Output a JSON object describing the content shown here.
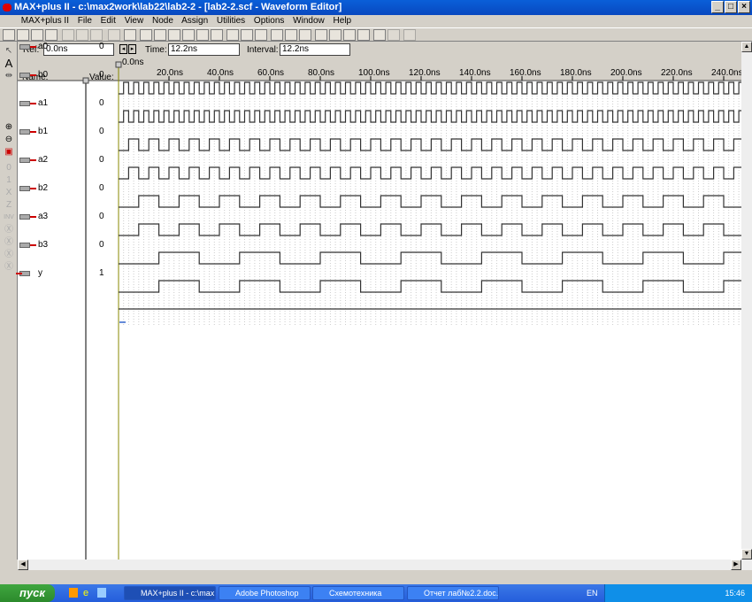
{
  "window": {
    "title": "MAX+plus II - c:\\max2work\\lab22\\lab2-2 - [lab2-2.scf - Waveform Editor]"
  },
  "menu": [
    "MAX+plus II",
    "File",
    "Edit",
    "View",
    "Node",
    "Assign",
    "Utilities",
    "Options",
    "Window",
    "Help"
  ],
  "editor": {
    "ref_label": "Ref:",
    "ref_value": "0.0ns",
    "time_label": "Time:",
    "time_value": "12.2ns",
    "interval_label": "Interval:",
    "interval_value": "12.2ns",
    "cursor_label": "0.0ns",
    "name_header": "Name:",
    "value_header": "Value:"
  },
  "chart_data": {
    "type": "waveform",
    "x_unit": "ns",
    "xlim": [
      0,
      247
    ],
    "ticks": [
      "20.0ns",
      "40.0ns",
      "60.0ns",
      "80.0ns",
      "100.0ns",
      "120.0ns",
      "140.0ns",
      "160.0ns",
      "180.0ns",
      "200.0ns",
      "220.0ns",
      "240.0ns"
    ],
    "tick_values": [
      20,
      40,
      60,
      80,
      100,
      120,
      140,
      160,
      180,
      200,
      220,
      240
    ],
    "signals": [
      {
        "name": "a0",
        "value": "0",
        "type": "input",
        "half_period_ns": 2,
        "initial": 0
      },
      {
        "name": "b0",
        "value": "0",
        "type": "input",
        "half_period_ns": 2,
        "initial": 0
      },
      {
        "name": "a1",
        "value": "0",
        "type": "input",
        "half_period_ns": 4,
        "initial": 0
      },
      {
        "name": "b1",
        "value": "0",
        "type": "input",
        "half_period_ns": 4,
        "initial": 0
      },
      {
        "name": "a2",
        "value": "0",
        "type": "input",
        "half_period_ns": 8,
        "initial": 0
      },
      {
        "name": "b2",
        "value": "0",
        "type": "input",
        "half_period_ns": 8,
        "initial": 0
      },
      {
        "name": "a3",
        "value": "0",
        "type": "input",
        "half_period_ns": 16,
        "initial": 0
      },
      {
        "name": "b3",
        "value": "0",
        "type": "input",
        "half_period_ns": 16,
        "initial": 0
      },
      {
        "name": "y",
        "value": "1",
        "type": "output",
        "half_period_ns": 0,
        "initial": 1
      }
    ]
  },
  "taskbar": {
    "start": "пуск",
    "tasks": [
      "MAX+plus II - c:\\max...",
      "Adobe Photoshop",
      "Схемотехника",
      "Отчет лаб№2.2.doc..."
    ],
    "lang": "EN",
    "clock": "15:46"
  }
}
